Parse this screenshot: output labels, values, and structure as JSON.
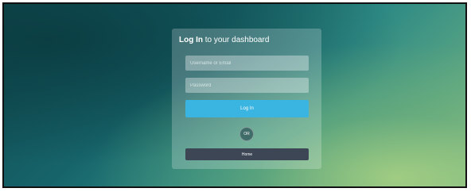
{
  "login": {
    "title_bold": "Log In",
    "title_rest": " to your dashboard",
    "username_placeholder": "Username or Email",
    "password_placeholder": "Password",
    "login_label": "Log In",
    "or_label": "OR",
    "home_label": "Home"
  },
  "colors": {
    "login_button": "#3ab4e0",
    "home_button": "#3c4654"
  }
}
